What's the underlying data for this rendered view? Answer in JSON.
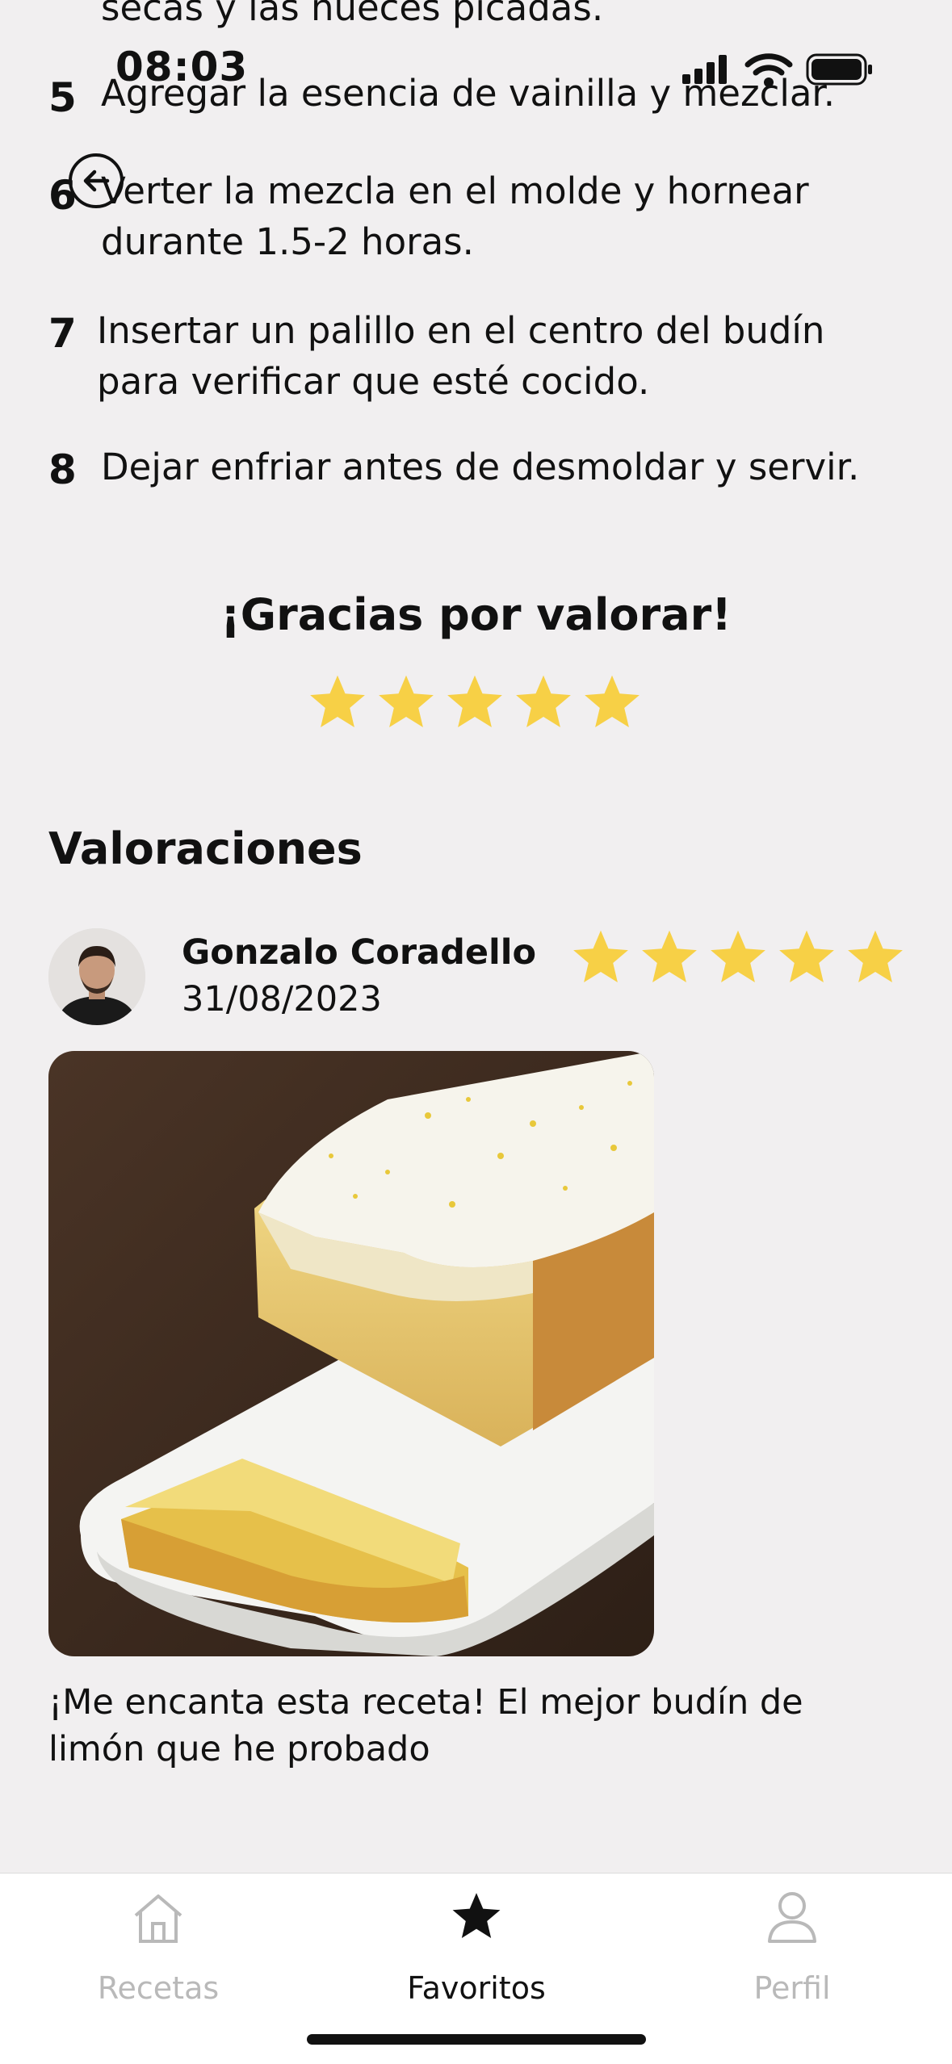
{
  "status_bar": {
    "time": "08:03"
  },
  "steps": {
    "partial_text": "secas y las nueces picadas.",
    "items": [
      {
        "num": "5",
        "text": "Agregar la esencia de vainilla y mezclar."
      },
      {
        "num": "6",
        "text": "Verter la mezcla en el molde y hornear durante 1.5-2 horas."
      },
      {
        "num": "7",
        "text": "Insertar un palillo en el centro del budín para verificar que esté cocido."
      },
      {
        "num": "8",
        "text": "Dejar enfriar antes de desmoldar y servir."
      }
    ]
  },
  "rating": {
    "thanks_text": "¡Gracias por valorar!",
    "user_stars": 5,
    "star_color": "#f7d046"
  },
  "reviews": {
    "section_title": "Valoraciones",
    "items": [
      {
        "name": "Gonzalo Coradello",
        "date": "31/08/2023",
        "stars": 5,
        "comment": "¡Me encanta esta receta! El mejor budín de limón que he probado"
      }
    ]
  },
  "tabbar": {
    "tabs": [
      {
        "label": "Recetas",
        "icon": "home-icon",
        "active": false
      },
      {
        "label": "Favoritos",
        "icon": "star-icon",
        "active": true
      },
      {
        "label": "Perfil",
        "icon": "user-icon",
        "active": false
      }
    ],
    "active_color": "#111111",
    "inactive_color": "#b9b9b9"
  }
}
